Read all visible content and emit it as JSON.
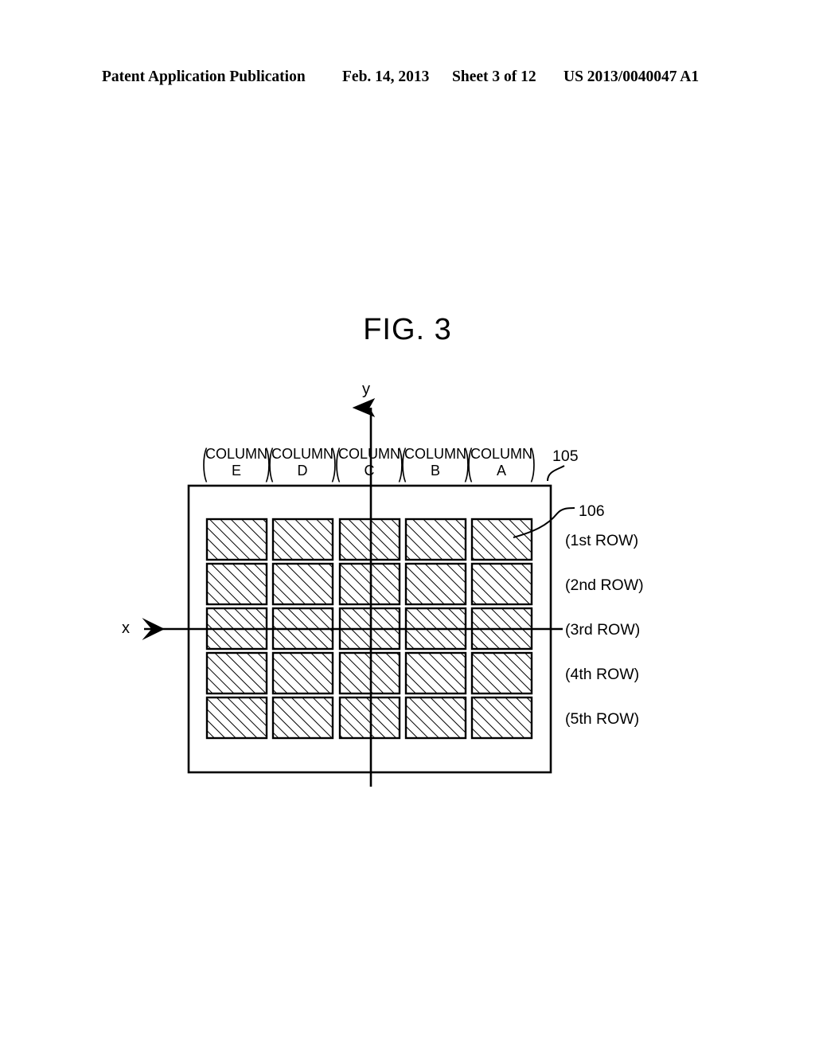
{
  "header": {
    "publication": "Patent Application Publication",
    "date": "Feb. 14, 2013",
    "sheet": "Sheet 3 of 12",
    "patent_number": "US 2013/0040047 A1"
  },
  "figure": {
    "title": "FIG. 3",
    "axes": {
      "y_label": "y",
      "x_label": "x"
    },
    "reference_numerals": {
      "outer_frame": "105",
      "cell": "106"
    },
    "columns": [
      {
        "word": "COLUMN",
        "letter": "E"
      },
      {
        "word": "COLUMN",
        "letter": "D"
      },
      {
        "word": "COLUMN",
        "letter": "C"
      },
      {
        "word": "COLUMN",
        "letter": "B"
      },
      {
        "word": "COLUMN",
        "letter": "A"
      }
    ],
    "rows": [
      {
        "label": "(1st ROW)"
      },
      {
        "label": "(2nd ROW)"
      },
      {
        "label": "(3rd ROW)"
      },
      {
        "label": "(4th ROW)"
      },
      {
        "label": "(5th ROW)"
      }
    ],
    "grid": {
      "columns_count": 5,
      "rows_count": 5,
      "cell_fill": "diagonal-hatch",
      "line_color": "#000000"
    }
  }
}
